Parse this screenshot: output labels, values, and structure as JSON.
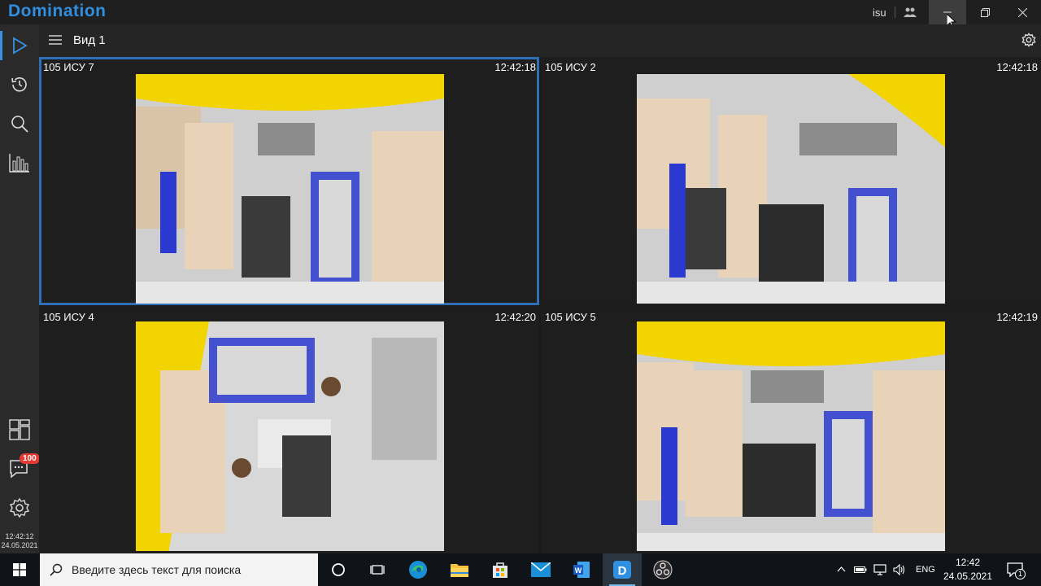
{
  "titlebar": {
    "app_title": "Domination",
    "user": "isu"
  },
  "toolbar": {
    "view_name": "Вид 1"
  },
  "sidebar": {
    "notifications_badge": "100",
    "clock_time": "12:42:12",
    "clock_date": "24.05.2021"
  },
  "cameras": [
    {
      "name": "105 ИСУ 7",
      "time": "12:42:18"
    },
    {
      "name": "105 ИСУ 2",
      "time": "12:42:18"
    },
    {
      "name": "105 ИСУ 4",
      "time": "12:42:20"
    },
    {
      "name": "105 ИСУ 5",
      "time": "12:42:19"
    }
  ],
  "taskbar": {
    "search_placeholder": "Введите здесь текст для поиска",
    "lang": "ENG",
    "time": "12:42",
    "date": "24.05.2021",
    "notifications_count": "1"
  },
  "colors": {
    "accent": "#2f8fe0",
    "selection": "#2f6fb7",
    "badge": "#e53935",
    "feed_wall": "#f2d400"
  },
  "icons": {
    "sidebar": [
      "play-icon",
      "history-icon",
      "search-icon",
      "analytics-icon",
      "layout-icon",
      "chat-icon",
      "settings-icon"
    ],
    "taskbar": [
      "windows-icon",
      "cortana-icon",
      "task-view-icon",
      "edge-icon",
      "file-explorer-icon",
      "store-icon",
      "mail-icon",
      "word-icon",
      "domination-icon",
      "obs-icon"
    ]
  }
}
